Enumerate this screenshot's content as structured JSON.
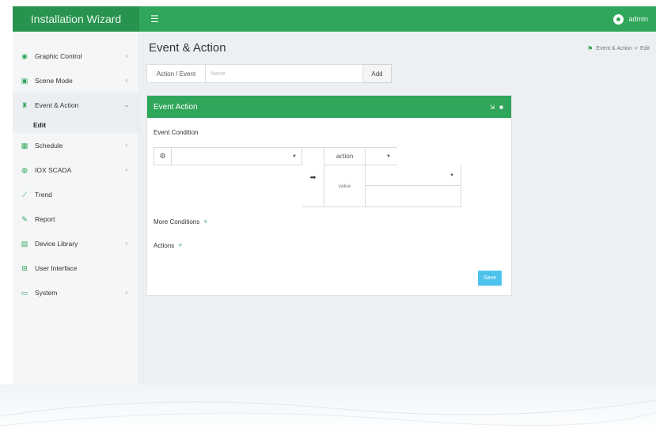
{
  "app": {
    "brand": "Installation Wizard",
    "menu_icon": "hamburger-icon"
  },
  "user": {
    "name": "admin",
    "avatar_icon": "user-avatar-icon"
  },
  "sidebar": {
    "items": [
      {
        "label": "Graphic Control",
        "icon": "eye-icon",
        "chevron": "‹"
      },
      {
        "label": "Scene Mode",
        "icon": "image-icon",
        "chevron": "‹"
      },
      {
        "label": "Event & Action",
        "icon": "trophy-icon",
        "chevron": "⌄"
      },
      {
        "label": "Schedule",
        "icon": "calendar-icon",
        "chevron": "‹"
      },
      {
        "label": "IOX SCADA",
        "icon": "globe-icon",
        "chevron": "‹"
      },
      {
        "label": "Trend",
        "icon": "line-chart-icon",
        "chevron": ""
      },
      {
        "label": "Report",
        "icon": "pencil-icon",
        "chevron": ""
      },
      {
        "label": "Device Library",
        "icon": "list-icon",
        "chevron": "‹"
      },
      {
        "label": "User Interface",
        "icon": "sitemap-icon",
        "chevron": ""
      },
      {
        "label": "System",
        "icon": "desktop-icon",
        "chevron": "‹"
      }
    ],
    "active_sub": "Edit"
  },
  "page": {
    "title": "Event & Action",
    "breadcrumb": {
      "parent": "Event & Action",
      "separator": ">",
      "current": "Edit"
    }
  },
  "action_event": {
    "label": "Action / Event",
    "placeholder": "Name",
    "add_label": "Add"
  },
  "panel": {
    "title": "Event Action",
    "event_condition_label": "Event Condition",
    "action_label": "action",
    "value_label": "value",
    "more_conditions_label": "More Conditions",
    "actions_label": "Actions",
    "save_label": "Save"
  },
  "colors": {
    "accent": "#2fa65a",
    "save": "#4cc2ec"
  }
}
